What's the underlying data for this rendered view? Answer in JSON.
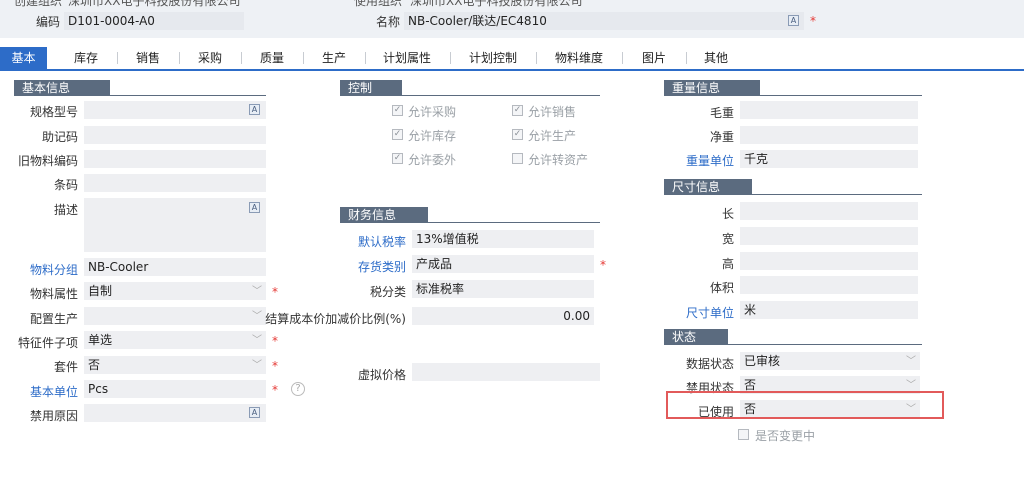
{
  "header": {
    "top_row": [
      {
        "label": "创建组织",
        "value": "深圳市XX电子科技股份有限公司"
      },
      {
        "label": "使用组织",
        "value": "深圳市XX电子科技股份有限公司"
      }
    ],
    "code_label": "编码",
    "code_value": "D101-0004-A0",
    "name_label": "名称",
    "name_value": "NB-Cooler/联达/EC4810"
  },
  "tabs": [
    "基本",
    "库存",
    "销售",
    "采购",
    "质量",
    "生产",
    "计划属性",
    "计划控制",
    "物料维度",
    "图片",
    "其他"
  ],
  "basic_info": {
    "title": "基本信息",
    "spec_label": "规格型号",
    "spec_value": "",
    "mnemonic_label": "助记码",
    "mnemonic_value": "",
    "old_code_label": "旧物料编码",
    "old_code_value": "",
    "barcode_label": "条码",
    "barcode_value": "",
    "desc_label": "描述",
    "desc_value": "",
    "group_label": "物料分组",
    "group_value": "NB-Cooler",
    "attr_label": "物料属性",
    "attr_value": "自制",
    "config_label": "配置生产",
    "config_value": "",
    "feature_label": "特征件子项",
    "feature_value": "单选",
    "kit_label": "套件",
    "kit_value": "否",
    "unit_label": "基本单位",
    "unit_value": "Pcs",
    "disable_reason_label": "禁用原因",
    "disable_reason_value": ""
  },
  "control": {
    "title": "控制",
    "items": [
      {
        "label": "允许采购",
        "checked": true
      },
      {
        "label": "允许销售",
        "checked": true
      },
      {
        "label": "允许库存",
        "checked": true
      },
      {
        "label": "允许生产",
        "checked": true
      },
      {
        "label": "允许委外",
        "checked": true
      },
      {
        "label": "允许转资产",
        "checked": false
      }
    ]
  },
  "finance": {
    "title": "财务信息",
    "tax_rate_label": "默认税率",
    "tax_rate_value": "13%增值税",
    "stock_type_label": "存货类别",
    "stock_type_value": "产成品",
    "tax_class_label": "税分类",
    "tax_class_value": "标准税率",
    "ratio_label": "结算成本价加减价比例(%)",
    "ratio_value": "0.00",
    "virtual_price_label": "虚拟价格",
    "virtual_price_value": ""
  },
  "weight": {
    "title": "重量信息",
    "gross_label": "毛重",
    "gross_value": "",
    "net_label": "净重",
    "net_value": "",
    "unit_label": "重量单位",
    "unit_value": "千克"
  },
  "size": {
    "title": "尺寸信息",
    "length_label": "长",
    "length_value": "",
    "width_label": "宽",
    "width_value": "",
    "height_label": "高",
    "height_value": "",
    "volume_label": "体积",
    "volume_value": "",
    "unit_label": "尺寸单位",
    "unit_value": "米"
  },
  "status": {
    "title": "状态",
    "data_status_label": "数据状态",
    "data_status_value": "已审核",
    "disable_status_label": "禁用状态",
    "disable_status_value": "否",
    "used_label": "已使用",
    "used_value": "否",
    "changing_label": "是否变更中"
  },
  "colors": {
    "accent": "#2d6cc8",
    "section": "#5b6b7f",
    "highlight": "#e25a5a",
    "required": "#e53935"
  },
  "icons": {
    "lang": "A",
    "help": "?",
    "dropdown": "﹀",
    "check": "✓"
  }
}
